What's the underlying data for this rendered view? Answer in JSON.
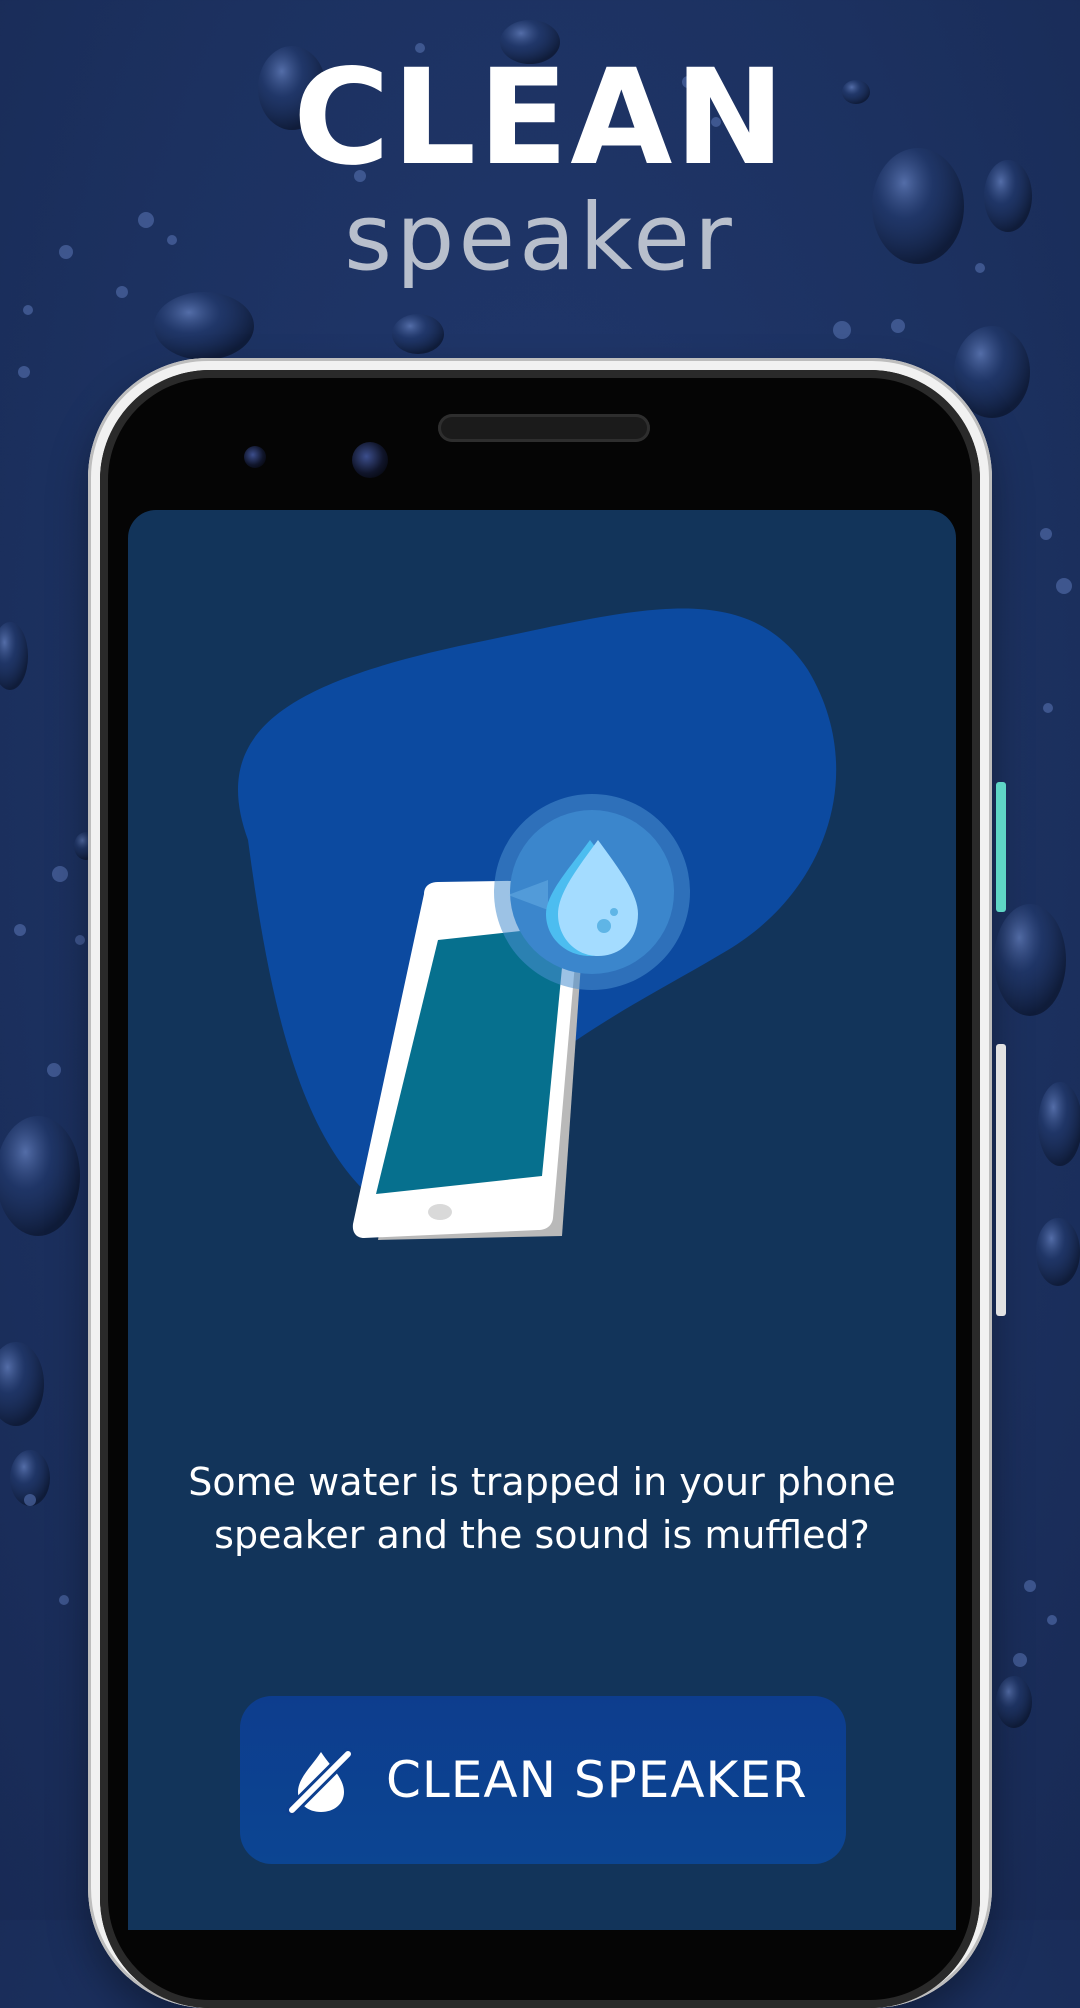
{
  "hero": {
    "title": "CLEAN",
    "subtitle": "speaker"
  },
  "screen": {
    "message": "Some water is trapped in your phone speaker and the sound is muffled?",
    "illustration_icons": [
      "phone-icon",
      "water-drop-icon"
    ]
  },
  "action": {
    "button_label": "CLEAN SPEAKER",
    "button_icon": "water-off-icon"
  },
  "colors": {
    "background": "#1f3565",
    "screen": "#12345a",
    "blob": "#0c4aa0",
    "button": "#0d3f8f",
    "accent_drop": "#8fd3ff"
  }
}
